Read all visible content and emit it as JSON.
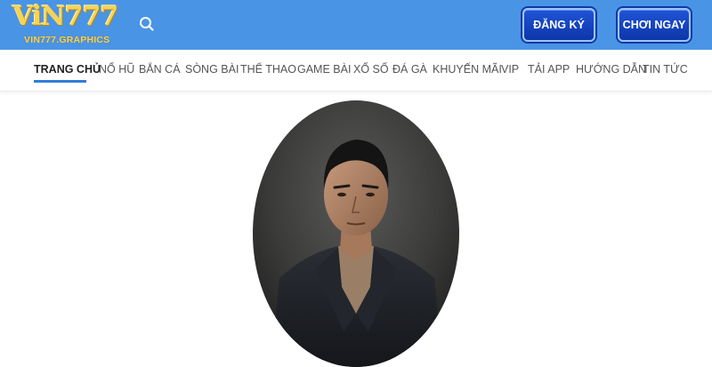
{
  "header": {
    "logo_text": "ViN777",
    "logo_domain": "VIN777.GRAPHICS",
    "search_icon": "search-icon",
    "register_label": "ĐĂNG KÝ",
    "play_label": "CHƠI NGAY",
    "colors": {
      "header_bg": "#4a94e6",
      "cta_bg": "#1f54d8",
      "logo_gold": "#f4d35a"
    }
  },
  "nav": {
    "items": [
      {
        "label": "TRANG CHỦ",
        "active": true
      },
      {
        "label": "NỔ HŨ"
      },
      {
        "label": "BẮN CÁ"
      },
      {
        "label": "SÒNG BÀI"
      },
      {
        "label": "THỂ THAO"
      },
      {
        "label": "GAME BÀI"
      },
      {
        "label": "XỔ SỐ"
      },
      {
        "label": "ĐÁ GÀ"
      },
      {
        "label": "KHUYẾN MÃI"
      },
      {
        "label": "VIP"
      },
      {
        "label": "TẢI APP"
      },
      {
        "label": "HƯỚNG DẪN"
      },
      {
        "label": "TIN TỨC"
      }
    ],
    "active_color": "#2f7ed8"
  },
  "hero": {
    "image": "author-portrait"
  }
}
